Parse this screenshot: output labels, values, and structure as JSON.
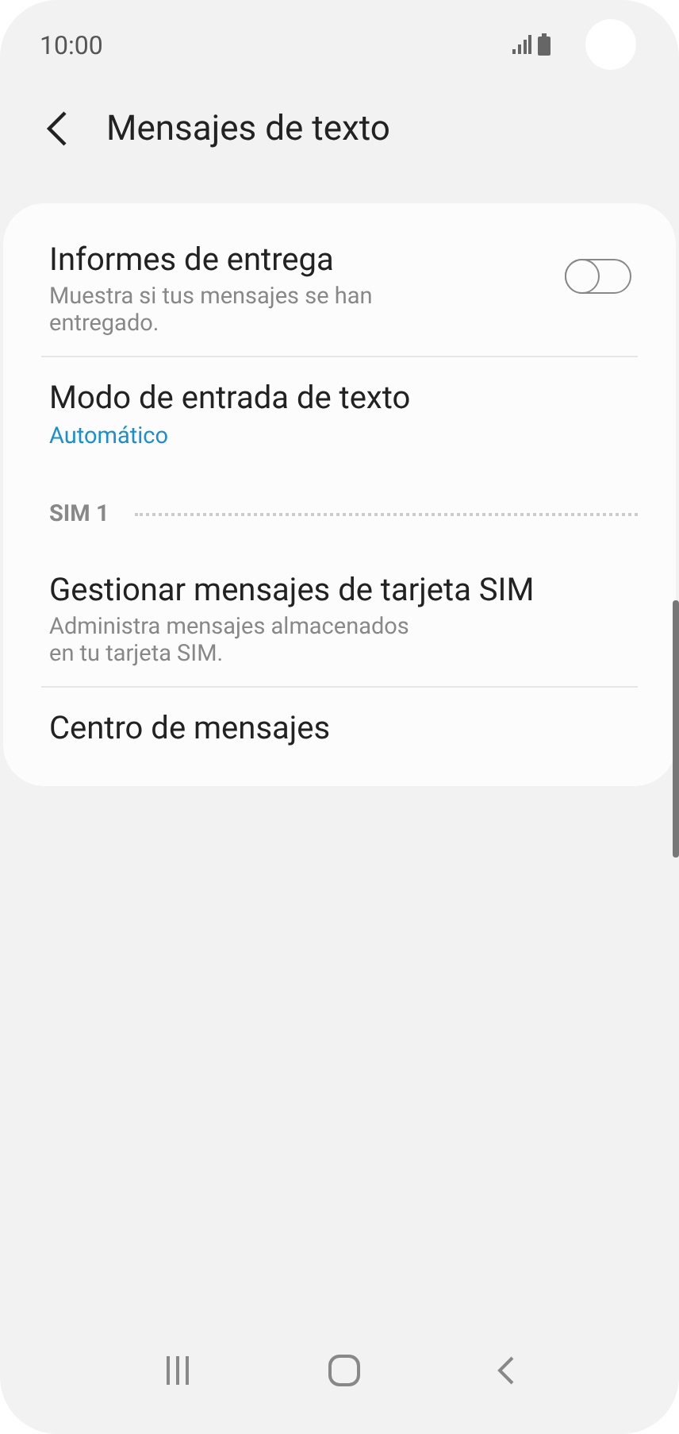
{
  "status_bar": {
    "time": "10:00"
  },
  "header": {
    "title": "Mensajes de texto"
  },
  "items": [
    {
      "kind": "toggle",
      "title": "Informes de entrega",
      "subtitle": "Muestra si tus mensajes se han entregado.",
      "on": false
    },
    {
      "kind": "value",
      "title": "Modo de entrada de texto",
      "value": "Automático"
    },
    {
      "kind": "section",
      "title": "SIM 1"
    },
    {
      "kind": "plain",
      "title": "Gestionar mensajes de tarjeta SIM",
      "subtitle": "Administra mensajes almacenados en tu tarjeta SIM."
    },
    {
      "kind": "plain",
      "title": "Centro de mensajes"
    }
  ]
}
